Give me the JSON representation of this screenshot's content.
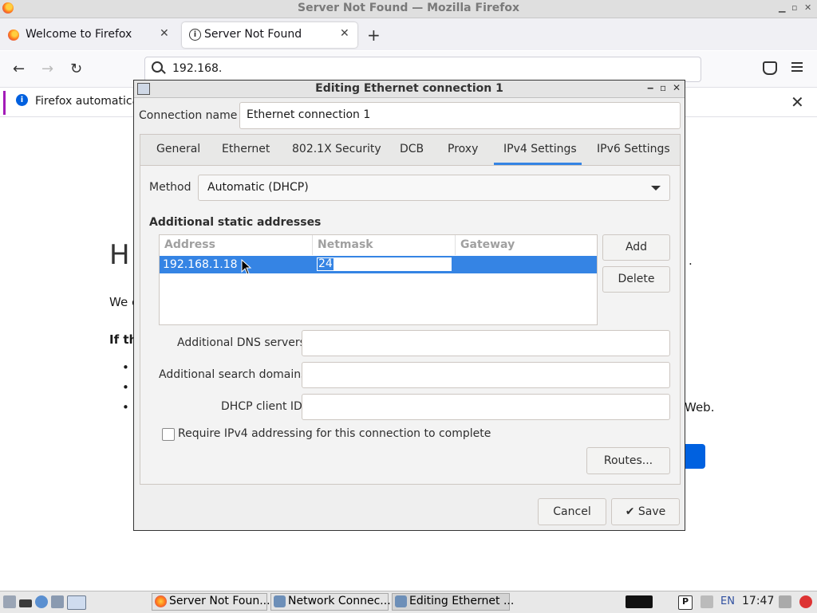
{
  "firefox": {
    "window_title": "Server Not Found — Mozilla Firefox",
    "tabs": [
      {
        "label": "Welcome to Firefox"
      },
      {
        "label": "Server Not Found"
      }
    ],
    "url": "192.168.",
    "infobar_text": "Firefox automatica",
    "page": {
      "heading_partial": "H",
      "paragraph_partial": "We c",
      "bold_partial": "If th",
      "bullet_tail": "Web.",
      "dot": "."
    }
  },
  "dialog": {
    "title": "Editing Ethernet connection 1",
    "connection_name_label": "Connection name",
    "connection_name_value": "Ethernet connection 1",
    "tabs": [
      "General",
      "Ethernet",
      "802.1X Security",
      "DCB",
      "Proxy",
      "IPv4 Settings",
      "IPv6 Settings"
    ],
    "active_tab": "IPv4 Settings",
    "method_label": "Method",
    "method_value": "Automatic (DHCP)",
    "static_heading": "Additional static addresses",
    "table": {
      "columns": [
        "Address",
        "Netmask",
        "Gateway"
      ],
      "rows": [
        {
          "address": "192.168.1.18",
          "netmask": "24",
          "gateway": ""
        }
      ]
    },
    "add_label": "Add",
    "delete_label": "Delete",
    "dns_label": "Additional DNS servers",
    "search_label": "Additional search domains",
    "dhcp_label": "DHCP client ID",
    "require_label": "Require IPv4 addressing for this connection to complete",
    "routes_label": "Routes...",
    "cancel_label": "Cancel",
    "save_label": "Save",
    "accent_color": "#3584e4"
  },
  "taskbar": {
    "tasks": [
      {
        "label": "Server Not Foun..."
      },
      {
        "label": "Network Connec..."
      },
      {
        "label": "Editing Ethernet ..."
      }
    ],
    "lang": "EN",
    "clock": "17:47"
  }
}
